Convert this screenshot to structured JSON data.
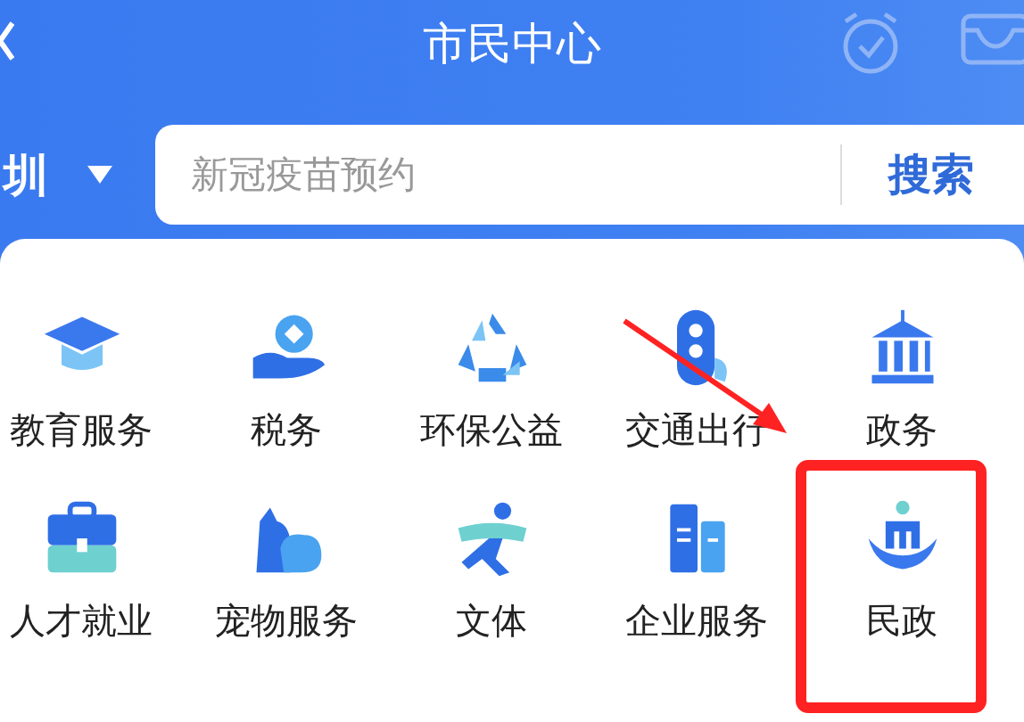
{
  "header": {
    "title": "市民中心"
  },
  "search": {
    "city": "圳",
    "placeholder": "新冠疫苗预约",
    "button": "搜索"
  },
  "services": [
    {
      "label": "教育服务"
    },
    {
      "label": "税务"
    },
    {
      "label": "环保公益"
    },
    {
      "label": "交通出行"
    },
    {
      "label": "政务"
    },
    {
      "label": "人才就业"
    },
    {
      "label": "宠物服务"
    },
    {
      "label": "文体"
    },
    {
      "label": "企业服务"
    },
    {
      "label": "民政"
    }
  ]
}
